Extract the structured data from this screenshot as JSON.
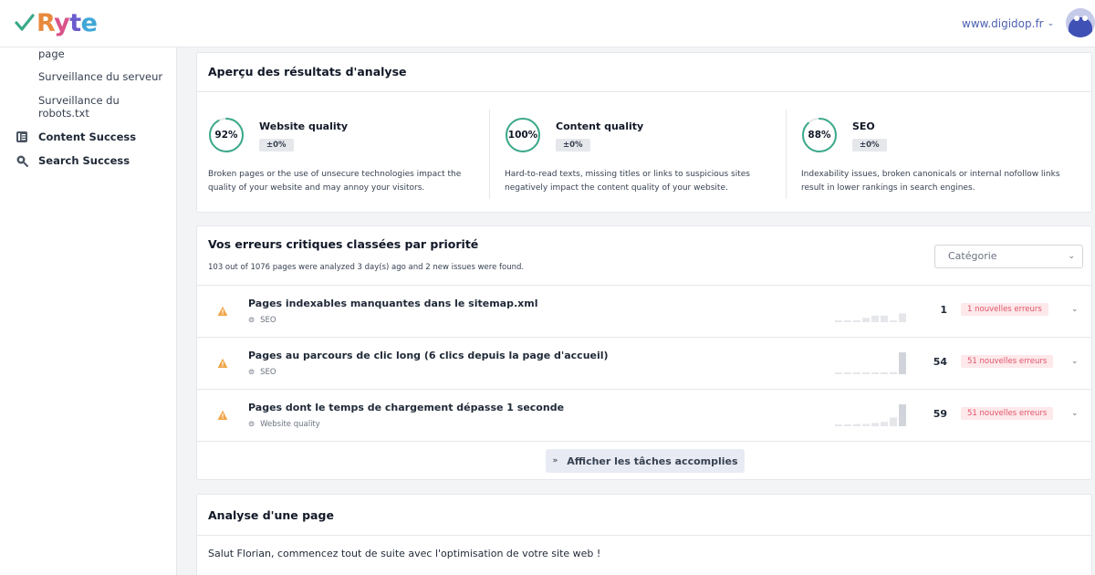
{
  "header": {
    "logo_text": "Ryte",
    "site": "www.digidop.fr"
  },
  "sidebar": {
    "sub_items": [
      {
        "label": "page"
      },
      {
        "label": "Surveillance du serveur"
      },
      {
        "label": "Surveillance du robots.txt"
      }
    ],
    "main_items": [
      {
        "label": "Content Success",
        "icon": "content-icon"
      },
      {
        "label": "Search Success",
        "icon": "search-icon"
      }
    ]
  },
  "overview": {
    "title": "Aperçu des résultats d'analyse",
    "metrics": [
      {
        "name": "Website quality",
        "value": "92%",
        "fraction": 0.92,
        "delta": "±0%",
        "description": "Broken pages or the use of unsecure technologies impact the quality of your website and may annoy your visitors."
      },
      {
        "name": "Content quality",
        "value": "100%",
        "fraction": 1.0,
        "delta": "±0%",
        "description": "Hard-to-read texts, missing titles or links to suspicious sites negatively impact the content quality of your website."
      },
      {
        "name": "SEO",
        "value": "88%",
        "fraction": 0.88,
        "delta": "±0%",
        "description": "Indexability issues, broken canonicals or internal nofollow links result in lower rankings in search engines."
      }
    ]
  },
  "errors": {
    "title": "Vos erreurs critiques classées par priorité",
    "subtitle": "103 out of 1076 pages were analyzed 3 day(s) ago and 2 new issues were found.",
    "category_placeholder": "Catégorie",
    "rows": [
      {
        "title": "Pages indexables manquantes dans le sitemap.xml",
        "tag": "SEO",
        "count": "1",
        "badge": "1 nouvelles erreurs",
        "trend": [
          0,
          0,
          0,
          0.2,
          0.3,
          0.3,
          0,
          0.4
        ]
      },
      {
        "title": "Pages au parcours de clic long (6 clics depuis la page d'accueil)",
        "tag": "SEO",
        "count": "54",
        "badge": "51 nouvelles erreurs",
        "trend": [
          0,
          0,
          0,
          0,
          0,
          0,
          0.1,
          1.0
        ]
      },
      {
        "title": "Pages dont le temps de chargement dépasse 1 seconde",
        "tag": "Website quality",
        "count": "59",
        "badge": "51 nouvelles erreurs",
        "trend": [
          0,
          0,
          0.1,
          0.1,
          0.15,
          0.2,
          0.4,
          1.0
        ]
      }
    ],
    "show_completed_label": "Afficher les tâches accomplies"
  },
  "page_analysis": {
    "title": "Analyse d'une page",
    "greeting": "Salut Florian,  commencez tout de suite avec l'optimisation de votre site web !"
  },
  "colors": {
    "ring": "#3aa98a",
    "badge_text": "#e0556b",
    "badge_bg": "#fde8ea",
    "warning": "#f0a64a",
    "link": "#4b5fb0"
  }
}
